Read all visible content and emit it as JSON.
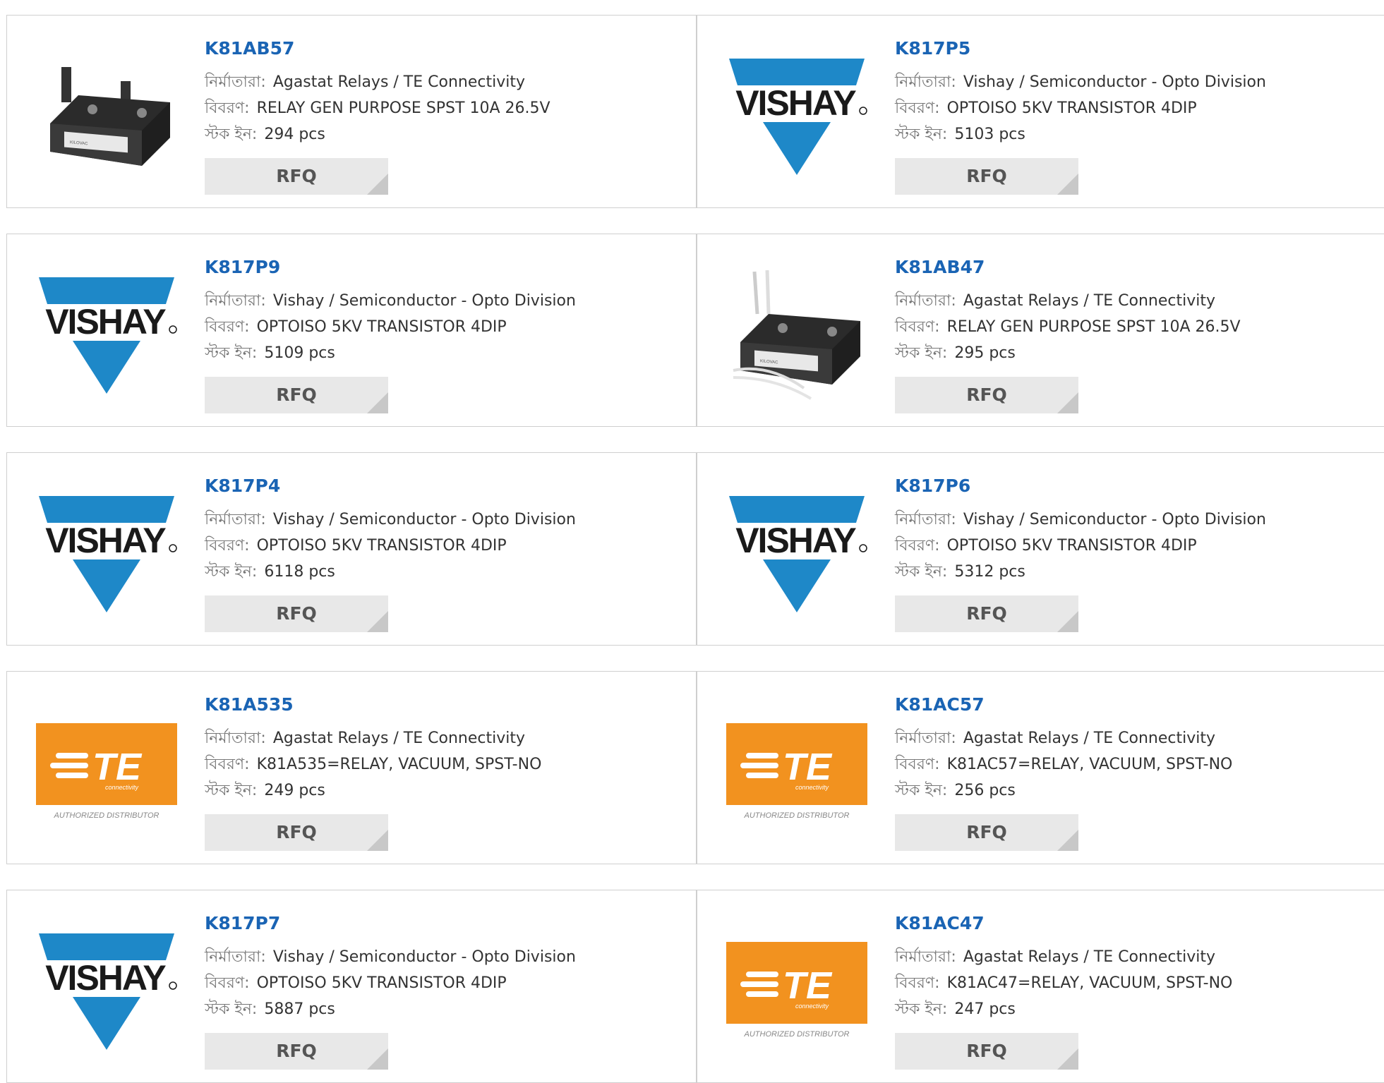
{
  "labels": {
    "manufacturer": "নির্মাতারা:",
    "description": "বিবরণ:",
    "stock": "স্টক ইন:",
    "rfq": "RFQ"
  },
  "colors": {
    "part_link": "#1a64b4",
    "vishay_blue": "#1e88c8",
    "te_orange": "#f2921f",
    "rfq_bg": "#e8e8e8"
  },
  "logos": {
    "vishay_text": "VISHAY",
    "te_text": "TE",
    "te_sub": "connectivity",
    "te_authorized": "AUTHORIZED DISTRIBUTOR",
    "relay_brand": "KILOVAC"
  },
  "products": [
    {
      "part": "K81AB57",
      "manufacturer": "Agastat Relays / TE Connectivity",
      "description": "RELAY GEN PURPOSE SPST 10A 26.5V",
      "stock": "294 pcs",
      "image": "relay-photo"
    },
    {
      "part": "K817P5",
      "manufacturer": "Vishay / Semiconductor - Opto Division",
      "description": "OPTOISO 5KV TRANSISTOR 4DIP",
      "stock": "5103 pcs",
      "image": "vishay-logo"
    },
    {
      "part": "K817P9",
      "manufacturer": "Vishay / Semiconductor - Opto Division",
      "description": "OPTOISO 5KV TRANSISTOR 4DIP",
      "stock": "5109 pcs",
      "image": "vishay-logo"
    },
    {
      "part": "K81AB47",
      "manufacturer": "Agastat Relays / TE Connectivity",
      "description": "RELAY GEN PURPOSE SPST 10A 26.5V",
      "stock": "295 pcs",
      "image": "relay-wired-photo"
    },
    {
      "part": "K817P4",
      "manufacturer": "Vishay / Semiconductor - Opto Division",
      "description": "OPTOISO 5KV TRANSISTOR 4DIP",
      "stock": "6118 pcs",
      "image": "vishay-logo"
    },
    {
      "part": "K817P6",
      "manufacturer": "Vishay / Semiconductor - Opto Division",
      "description": "OPTOISO 5KV TRANSISTOR 4DIP",
      "stock": "5312 pcs",
      "image": "vishay-logo"
    },
    {
      "part": "K81A535",
      "manufacturer": "Agastat Relays / TE Connectivity",
      "description": "K81A535=RELAY, VACUUM, SPST-NO",
      "stock": "249 pcs",
      "image": "te-logo"
    },
    {
      "part": "K81AC57",
      "manufacturer": "Agastat Relays / TE Connectivity",
      "description": "K81AC57=RELAY, VACUUM, SPST-NO",
      "stock": "256 pcs",
      "image": "te-logo"
    },
    {
      "part": "K817P7",
      "manufacturer": "Vishay / Semiconductor - Opto Division",
      "description": "OPTOISO 5KV TRANSISTOR 4DIP",
      "stock": "5887 pcs",
      "image": "vishay-logo"
    },
    {
      "part": "K81AC47",
      "manufacturer": "Agastat Relays / TE Connectivity",
      "description": "K81AC47=RELAY, VACUUM, SPST-NO",
      "stock": "247 pcs",
      "image": "te-logo"
    }
  ]
}
